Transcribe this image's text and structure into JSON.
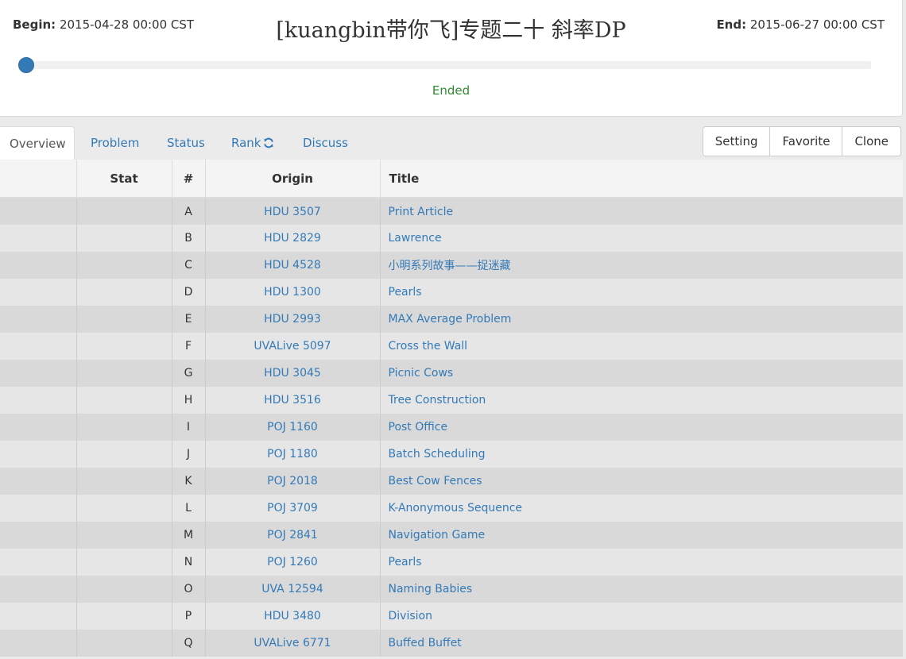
{
  "header": {
    "begin_label": "Begin:",
    "begin_value": "2015-04-28 00:00 CST",
    "end_label": "End:",
    "end_value": "2015-06-27 00:00 CST",
    "title": "[kuangbin带你飞]专题二十 斜率DP",
    "status": "Ended",
    "progress_percent": 0
  },
  "tabs": [
    {
      "label": "Overview",
      "active": true
    },
    {
      "label": "Problem"
    },
    {
      "label": "Status"
    },
    {
      "label": "Rank",
      "icon": "refresh-icon"
    },
    {
      "label": "Discuss"
    }
  ],
  "actions": {
    "setting": "Setting",
    "favorite": "Favorite",
    "clone": "Clone"
  },
  "table": {
    "columns": [
      "Stat",
      "#",
      "Origin",
      "Title"
    ],
    "rows": [
      {
        "stat": "",
        "num": "A",
        "origin": "HDU 3507",
        "title": "Print Article"
      },
      {
        "stat": "",
        "num": "B",
        "origin": "HDU 2829",
        "title": "Lawrence"
      },
      {
        "stat": "",
        "num": "C",
        "origin": "HDU 4528",
        "title": "小明系列故事——捉迷藏"
      },
      {
        "stat": "",
        "num": "D",
        "origin": "HDU 1300",
        "title": "Pearls"
      },
      {
        "stat": "",
        "num": "E",
        "origin": "HDU 2993",
        "title": "MAX Average Problem"
      },
      {
        "stat": "",
        "num": "F",
        "origin": "UVALive 5097",
        "title": "Cross the Wall"
      },
      {
        "stat": "",
        "num": "G",
        "origin": "HDU 3045",
        "title": "Picnic Cows"
      },
      {
        "stat": "",
        "num": "H",
        "origin": "HDU 3516",
        "title": "Tree Construction"
      },
      {
        "stat": "",
        "num": "I",
        "origin": "POJ 1160",
        "title": "Post Office"
      },
      {
        "stat": "",
        "num": "J",
        "origin": "POJ 1180",
        "title": "Batch Scheduling"
      },
      {
        "stat": "",
        "num": "K",
        "origin": "POJ 2018",
        "title": "Best Cow Fences"
      },
      {
        "stat": "",
        "num": "L",
        "origin": "POJ 3709",
        "title": "K-Anonymous Sequence"
      },
      {
        "stat": "",
        "num": "M",
        "origin": "POJ 2841",
        "title": "Navigation Game"
      },
      {
        "stat": "",
        "num": "N",
        "origin": "POJ 1260",
        "title": "Pearls"
      },
      {
        "stat": "",
        "num": "O",
        "origin": "UVA 12594",
        "title": "Naming Babies"
      },
      {
        "stat": "",
        "num": "P",
        "origin": "HDU 3480",
        "title": "Division"
      },
      {
        "stat": "",
        "num": "Q",
        "origin": "UVALive 6771",
        "title": "Buffed Buffet"
      }
    ]
  },
  "colors": {
    "link": "#337ab7",
    "status_ended": "#2e8b2e",
    "progress_handle": "#337ab7"
  }
}
